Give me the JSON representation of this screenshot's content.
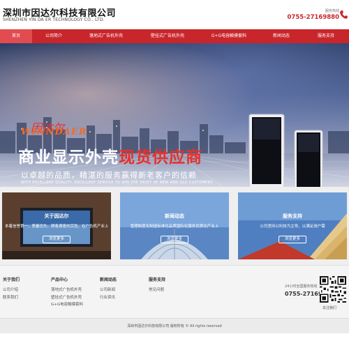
{
  "header": {
    "company_cn": "深圳市因达尔科技有限公司",
    "company_en": "SHENZHEN YIN DA ER TECHNOLOGY CO., LTD.",
    "hotline_label": "服务热线",
    "hotline_number": "0755-27169880"
  },
  "nav": {
    "items": [
      {
        "label": "首页",
        "active": true
      },
      {
        "label": "公司简介"
      },
      {
        "label": "落地式广告机外壳"
      },
      {
        "label": "壁挂式广告机外壳"
      },
      {
        "label": "G+G电容触摸套料"
      },
      {
        "label": "新闻动态"
      },
      {
        "label": "服务支持"
      }
    ]
  },
  "banner": {
    "brand_cn": "因达尔",
    "brand_en": "WINNDAER",
    "headline_white": "商业显示外壳",
    "headline_red": "现货供应商",
    "slogan": "以卓越的品质，精湛的服务赢得新老客户的信赖",
    "slogan_en": "WITH EXCELLENT QUALITY, EXCELLENT SERVICE TO WIN THE TRUST OF NEW AND OLD CUSTOMERS",
    "slides": 3,
    "active_slide": 1
  },
  "cards": [
    {
      "title": "关于因达尔",
      "text": "本着信誉第一，质量优先，顾客满意的宗旨，在广告机产业上的经营",
      "button": "浏览更多"
    },
    {
      "title": "新闻动态",
      "text": "管理制度化制造标准化品质国际化服务优质化产业上",
      "button": "浏览更多"
    },
    {
      "title": "服务支持",
      "text": "公司坚持以科技为主导，以满足用户需",
      "button": "浏览更多"
    }
  ],
  "footer": {
    "columns": [
      {
        "title": "关于我们",
        "links": [
          "公司介绍",
          "联系我们"
        ]
      },
      {
        "title": "产品中心",
        "links": [
          "落地式广告机外壳",
          "壁挂式广告机外壳",
          "G+G电容触摸套料"
        ]
      },
      {
        "title": "新闻动态",
        "links": [
          "公司新闻",
          "行业资讯"
        ]
      },
      {
        "title": "服务支持",
        "links": [
          "常见问题"
        ]
      }
    ],
    "hotline_label": "24小时全国服务热线",
    "hotline_number": "0755-27169880",
    "qr_label": "关注我们",
    "copyright": "深圳市因达尔科技有限公司 版权所有 © All rights reserved"
  },
  "colors": {
    "brand_red": "#c9262c",
    "nav_active": "#e24b50"
  }
}
